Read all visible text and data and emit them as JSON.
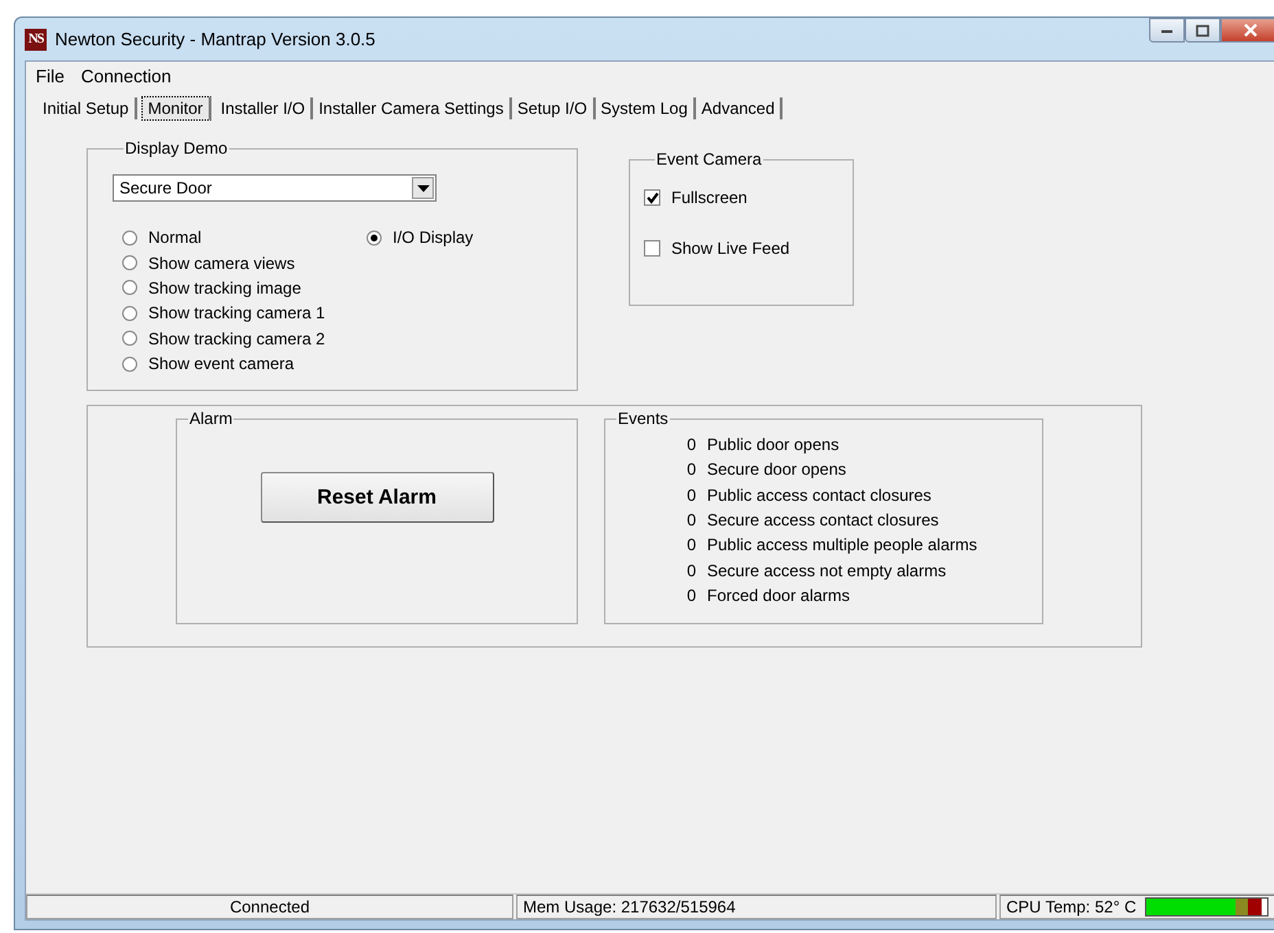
{
  "window": {
    "title": "Newton Security - Mantrap Version 3.0.5",
    "logo": "NS"
  },
  "menu": [
    "File",
    "Connection"
  ],
  "tabs": [
    {
      "label": "Initial Setup",
      "selected": false
    },
    {
      "label": "Monitor",
      "selected": true
    },
    {
      "label": "Installer I/O",
      "selected": false
    },
    {
      "label": "Installer Camera Settings",
      "selected": false
    },
    {
      "label": "Setup I/O",
      "selected": false
    },
    {
      "label": "System Log",
      "selected": false
    },
    {
      "label": "Advanced",
      "selected": false
    }
  ],
  "display_demo": {
    "title": "Display Demo",
    "dropdown": {
      "value": "Secure Door"
    },
    "options": [
      {
        "label": "Normal",
        "selected": false
      },
      {
        "label": "Show camera views",
        "selected": false
      },
      {
        "label": "Show tracking image",
        "selected": false
      },
      {
        "label": "Show tracking camera 1",
        "selected": false
      },
      {
        "label": "Show tracking camera 2",
        "selected": false
      },
      {
        "label": "Show event camera",
        "selected": false
      },
      {
        "label": "I/O Display",
        "selected": true
      }
    ]
  },
  "event_camera": {
    "title": "Event Camera",
    "options": [
      {
        "label": "Fullscreen",
        "checked": true
      },
      {
        "label": "Show Live Feed",
        "checked": false
      }
    ]
  },
  "alarm": {
    "title": "Alarm",
    "button": "Reset Alarm"
  },
  "events": {
    "title": "Events",
    "rows": [
      {
        "count": "0",
        "label": "Public door opens"
      },
      {
        "count": "0",
        "label": "Secure door opens"
      },
      {
        "count": "0",
        "label": "Public access contact closures"
      },
      {
        "count": "0",
        "label": "Secure access contact closures"
      },
      {
        "count": "0",
        "label": "Public access multiple people alarms"
      },
      {
        "count": "0",
        "label": "Secure access not empty alarms"
      },
      {
        "count": "0",
        "label": "Forced door alarms"
      }
    ]
  },
  "status_bar": {
    "connection": "Connected",
    "memory": "Mem Usage: 217632/515964",
    "cpu_temp": "CPU Temp: 52° C",
    "cpu_meter": {
      "level": 0.74
    }
  }
}
